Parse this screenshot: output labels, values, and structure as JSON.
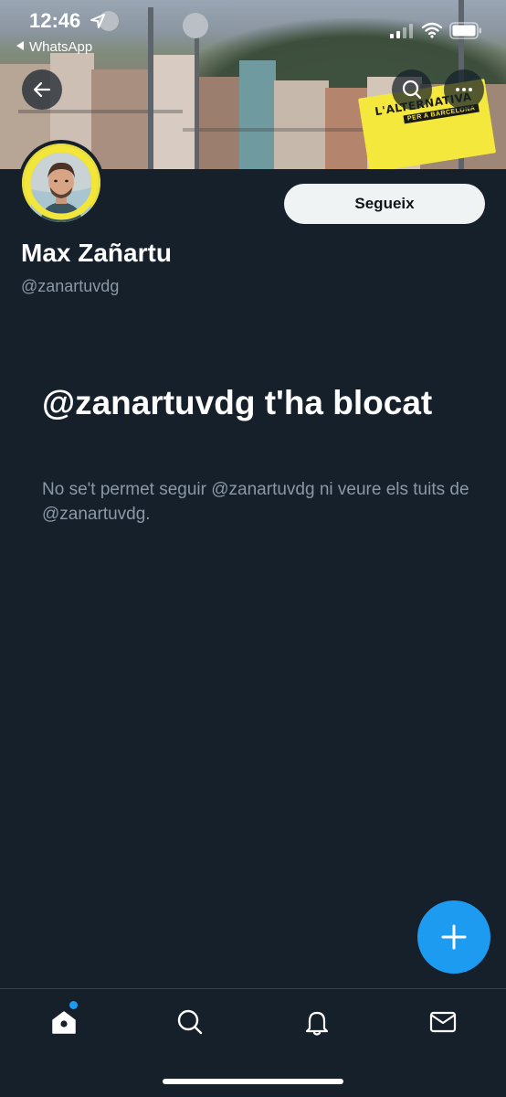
{
  "status_bar": {
    "time": "12:46",
    "back_app": "WhatsApp"
  },
  "header": {
    "poster_line1": "L'ALTERNATIVA",
    "poster_line2": "PER A BARCELONA"
  },
  "profile": {
    "name": "Max Zañartu",
    "handle": "@zanartuvdg",
    "follow_label": "Segueix"
  },
  "blocked": {
    "title": "@zanartuvdg t'ha blocat",
    "description": "No se't permet seguir @zanartuvdg ni veure els tuits de @zanartuvdg."
  },
  "icons": {
    "back": "arrow-left-icon",
    "search": "search-icon",
    "more": "more-icon",
    "compose": "plus-icon",
    "tabs": [
      "home-icon",
      "search-icon",
      "bell-icon",
      "mail-icon"
    ]
  },
  "colors": {
    "background": "#15202b",
    "accent": "#1d9bf0",
    "secondary_text": "#8b98a5",
    "follow_button_bg": "#eff3f4"
  }
}
